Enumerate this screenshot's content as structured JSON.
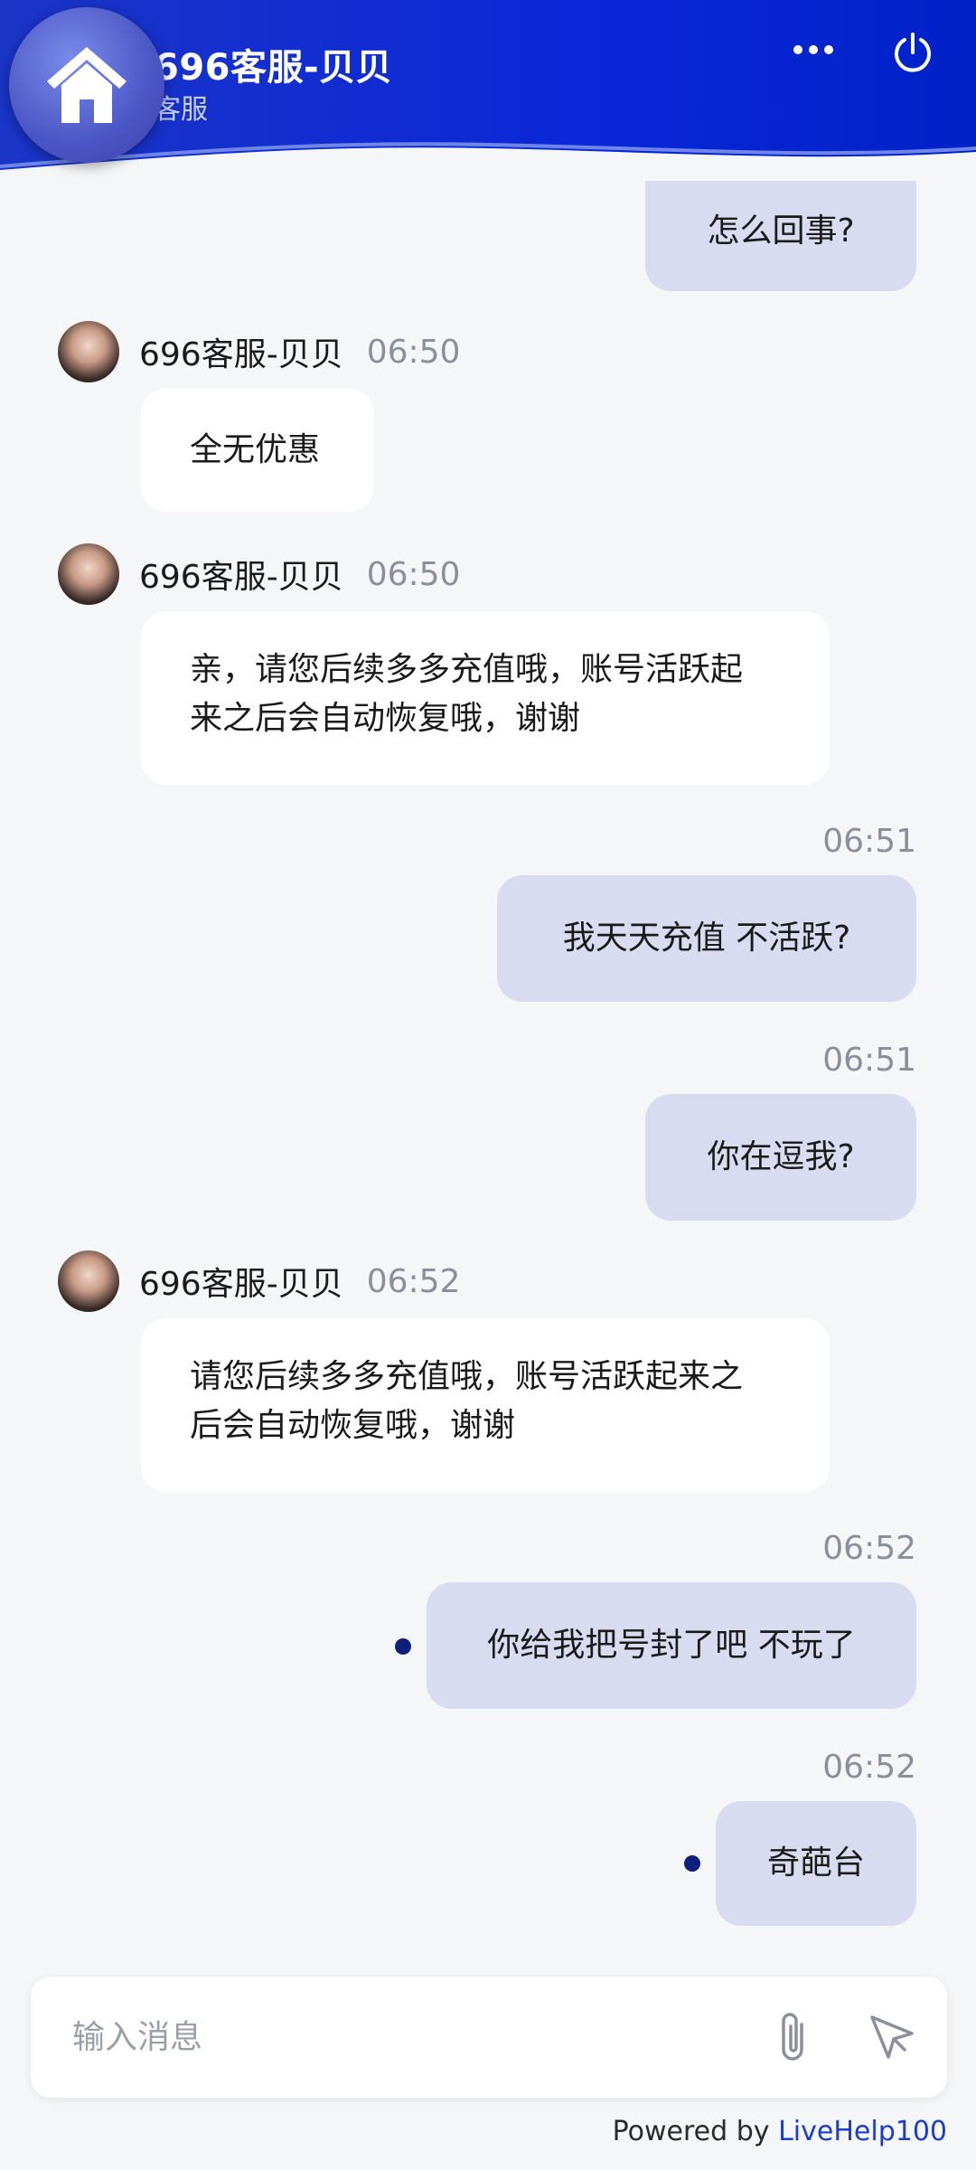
{
  "header": {
    "title": "696客服-贝贝",
    "subtitle": "客服",
    "more_icon": "more-horizontal-icon",
    "power_icon": "power-icon",
    "home_icon": "home-icon",
    "brand_color": "#0a27d8"
  },
  "messages": [
    {
      "side": "user",
      "text": "怎么回事?"
    },
    {
      "side": "agent",
      "sender": "696客服-贝贝",
      "time": "06:50",
      "text": "全无优惠"
    },
    {
      "side": "agent",
      "sender": "696客服-贝贝",
      "time": "06:50",
      "text_lines": [
        "亲，请您后续多多充值哦，账号活跃起",
        "来之后会自动恢复哦，谢谢"
      ]
    },
    {
      "side": "user",
      "time": "06:51",
      "text": "我天天充值 不活跃?"
    },
    {
      "side": "user",
      "time": "06:51",
      "text": "你在逗我?"
    },
    {
      "side": "agent",
      "sender": "696客服-贝贝",
      "time": "06:52",
      "text_lines": [
        "请您后续多多充值哦，账号活跃起来之",
        "后会自动恢复哦，谢谢"
      ]
    },
    {
      "side": "user",
      "time": "06:52",
      "text": "你给我把号封了吧 不玩了",
      "unread_dot": true
    },
    {
      "side": "user",
      "time": "06:52",
      "text": "奇葩台",
      "unread_dot": true
    }
  ],
  "input": {
    "placeholder": "输入消息",
    "attach_icon": "paperclip-icon",
    "send_icon": "send-icon"
  },
  "footer": {
    "prefix": "Powered by",
    "brand": "LiveHelp100"
  },
  "colors": {
    "user_bubble": "#d9dcf0",
    "agent_bubble": "#ffffff",
    "background": "#f5f6f8",
    "dot": "#0f1f7a"
  }
}
